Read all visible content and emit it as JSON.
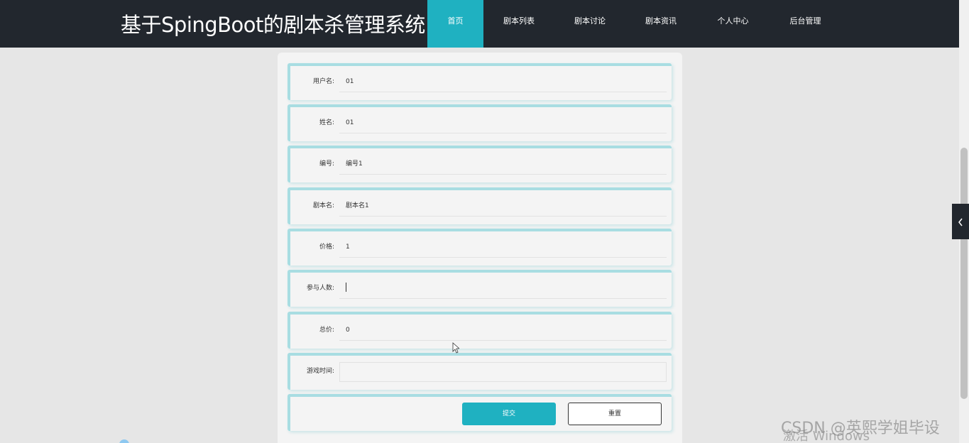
{
  "header": {
    "title": "基于SpingBoot的剧本杀管理系统",
    "nav": [
      {
        "label": "首页",
        "active": true
      },
      {
        "label": "剧本列表",
        "active": false
      },
      {
        "label": "剧本讨论",
        "active": false
      },
      {
        "label": "剧本资讯",
        "active": false
      },
      {
        "label": "个人中心",
        "active": false
      },
      {
        "label": "后台管理",
        "active": false
      }
    ]
  },
  "form": {
    "fields": [
      {
        "label": "用户名:",
        "value": "01"
      },
      {
        "label": "姓名:",
        "value": "01"
      },
      {
        "label": "编号:",
        "value": "编号1"
      },
      {
        "label": "剧本名:",
        "value": "剧本名1"
      },
      {
        "label": "价格:",
        "value": "1"
      },
      {
        "label": "参与人数:",
        "value": ""
      },
      {
        "label": "总价:",
        "value": "0"
      },
      {
        "label": "游戏时间:",
        "value": ""
      }
    ],
    "submit_label": "提交",
    "reset_label": "重置"
  },
  "side_toggle_icon": "chevron-left-icon",
  "watermarks": {
    "windows": "激活 Windows",
    "csdn": "CSDN @英熙学姐毕设"
  },
  "colors": {
    "accent": "#1fb1c1",
    "header_bg": "#22272e",
    "page_bg": "#e6e6e6"
  }
}
